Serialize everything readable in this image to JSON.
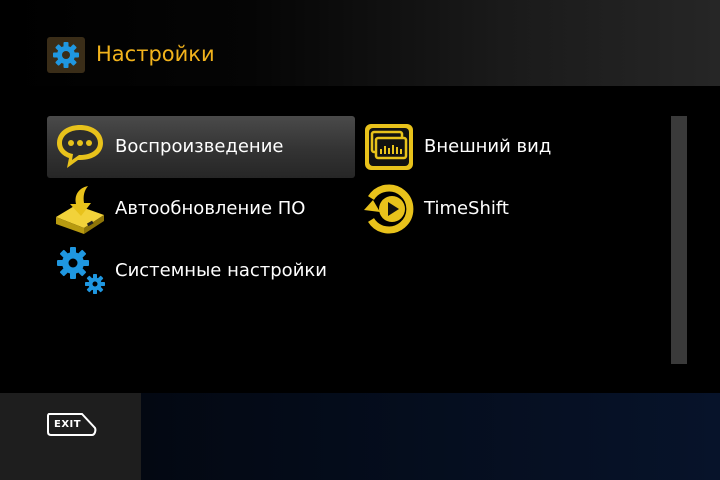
{
  "header": {
    "title": "Настройки",
    "icon": "gear-icon"
  },
  "menu": {
    "items": [
      {
        "label": "Воспроизведение",
        "icon": "speech-bubble-icon",
        "selected": true
      },
      {
        "label": "Автообновление ПО",
        "icon": "download-box-icon",
        "selected": false
      },
      {
        "label": "Системные настройки",
        "icon": "gears-icon",
        "selected": false
      },
      {
        "label": "Внешний вид",
        "icon": "tv-screen-icon",
        "selected": false
      },
      {
        "label": "TimeShift",
        "icon": "rewind-play-icon",
        "selected": false
      }
    ]
  },
  "footer": {
    "exit_label": "EXIT"
  },
  "colors": {
    "accent": "#f2b31c",
    "icon_yellow": "#e8c21b",
    "icon_blue": "#1f97e0",
    "text": "#ffffff"
  }
}
